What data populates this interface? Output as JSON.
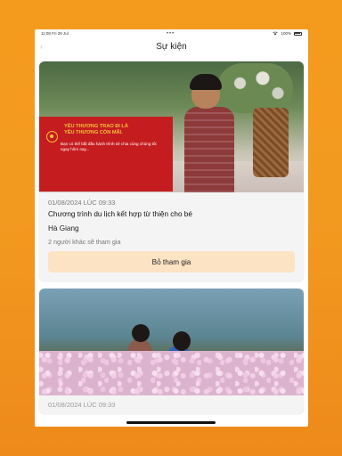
{
  "status_bar": {
    "time": "11:08",
    "date": "Fri 28 Jul",
    "center_dots": "•••",
    "battery_percent": "100%"
  },
  "nav": {
    "back_label": "‹",
    "title": "Sự kiện"
  },
  "banner": {
    "headline_1": "YÊU THƯƠNG TRAO ĐI LÀ",
    "headline_2": "YÊU THƯƠNG CÒN MÃI.",
    "text": "Bạn có thể bắt đầu hành trình sẻ chia cùng chúng tôi ngay hôm nay..."
  },
  "events": [
    {
      "date": "01/08/2024 LÚC 09:33",
      "title": "Chương trình du lịch kết hợp từ thiện cho bé",
      "location": "Hà Giang",
      "participants": "2 người khác sẽ tham gia",
      "action_label": "Bỏ tham gia"
    },
    {
      "date": "01/08/2024 LÚC 09:33"
    }
  ],
  "colors": {
    "background": "#f49b1e",
    "action_button_bg": "#fce3c4",
    "banner_red": "#c51d1f"
  }
}
